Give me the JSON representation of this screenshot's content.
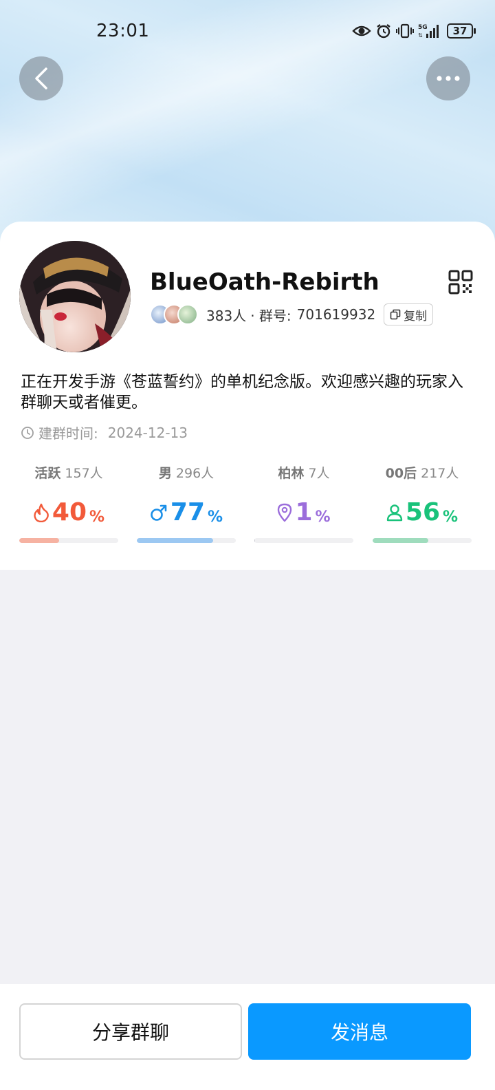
{
  "status_bar": {
    "time": "23:01",
    "battery": "37"
  },
  "group": {
    "name": "BlueOath-Rebirth",
    "member_count": "383人",
    "group_id_label": "· 群号:",
    "group_id": "701619932",
    "copy_label": "复制",
    "description": "正在开发手游《苍蓝誓约》的单机纪念版。欢迎感兴趣的玩家入群聊天或者催更。",
    "created_label": "建群时间:",
    "created_date": "2024-12-13"
  },
  "stats": [
    {
      "label": "活跃",
      "count": "157人",
      "value": "40",
      "unit": "%",
      "icon": "flame-icon",
      "color": "#f25a3a",
      "bar_color": "#f6b2a2",
      "level": 0.4
    },
    {
      "label": "男",
      "count": "296人",
      "value": "77",
      "unit": "%",
      "icon": "male-icon",
      "color": "#1a8fe8",
      "bar_color": "#9cc8f2",
      "level": 0.77
    },
    {
      "label": "柏林",
      "count": "7人",
      "value": "1",
      "unit": "%",
      "icon": "location-pin-icon",
      "color": "#9b6ddb",
      "bar_color": "#c9c9d0",
      "level": 0.01
    },
    {
      "label": "00后",
      "count": "217人",
      "value": "56",
      "unit": "%",
      "icon": "person-icon",
      "color": "#19c27a",
      "bar_color": "#9fdcbd",
      "level": 0.56
    }
  ],
  "actions": {
    "share_label": "分享群聊",
    "send_label": "发消息"
  },
  "colors": {
    "accent": "#0a99ff"
  }
}
